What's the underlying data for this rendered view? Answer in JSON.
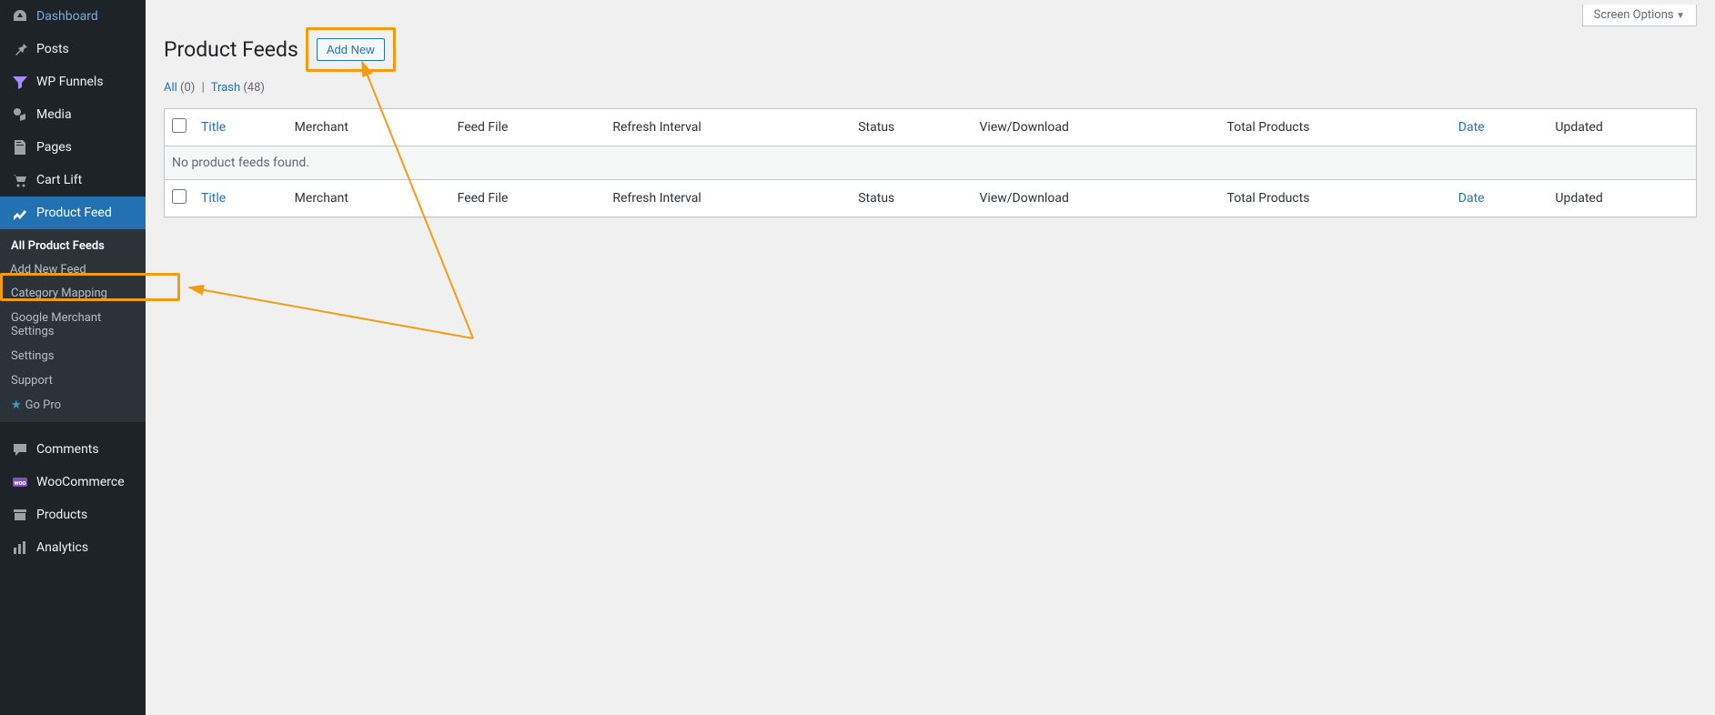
{
  "screen_options": "Screen Options",
  "page": {
    "title": "Product Feeds",
    "add_new": "Add New",
    "empty_msg": "No product feeds found."
  },
  "filters": {
    "all_label": "All",
    "all_count": "(0)",
    "sep": "|",
    "trash_label": "Trash",
    "trash_count": "(48)"
  },
  "columns": {
    "title": "Title",
    "merchant": "Merchant",
    "feed_file": "Feed File",
    "refresh": "Refresh Interval",
    "status": "Status",
    "view": "View/Download",
    "total": "Total Products",
    "date": "Date",
    "updated": "Updated"
  },
  "sidebar": {
    "items": [
      {
        "label": "Dashboard",
        "icon": "gauge"
      },
      {
        "label": "Posts",
        "icon": "pin"
      },
      {
        "label": "WP Funnels",
        "icon": "funnel"
      },
      {
        "label": "Media",
        "icon": "media"
      },
      {
        "label": "Pages",
        "icon": "page"
      },
      {
        "label": "Cart Lift",
        "icon": "cartlift"
      },
      {
        "label": "Product Feed",
        "icon": "chart",
        "active": true
      },
      {
        "label": "Comments",
        "icon": "comment"
      },
      {
        "label": "WooCommerce",
        "icon": "woo"
      },
      {
        "label": "Products",
        "icon": "archive"
      },
      {
        "label": "Analytics",
        "icon": "bars"
      }
    ],
    "submenu": [
      {
        "label": "All Product Feeds",
        "active": true
      },
      {
        "label": "Add New Feed",
        "highlighted": true
      },
      {
        "label": "Category Mapping"
      },
      {
        "label": "Google Merchant Settings"
      },
      {
        "label": "Settings"
      },
      {
        "label": "Support"
      },
      {
        "label": "Go Pro",
        "icon": "star"
      }
    ]
  }
}
